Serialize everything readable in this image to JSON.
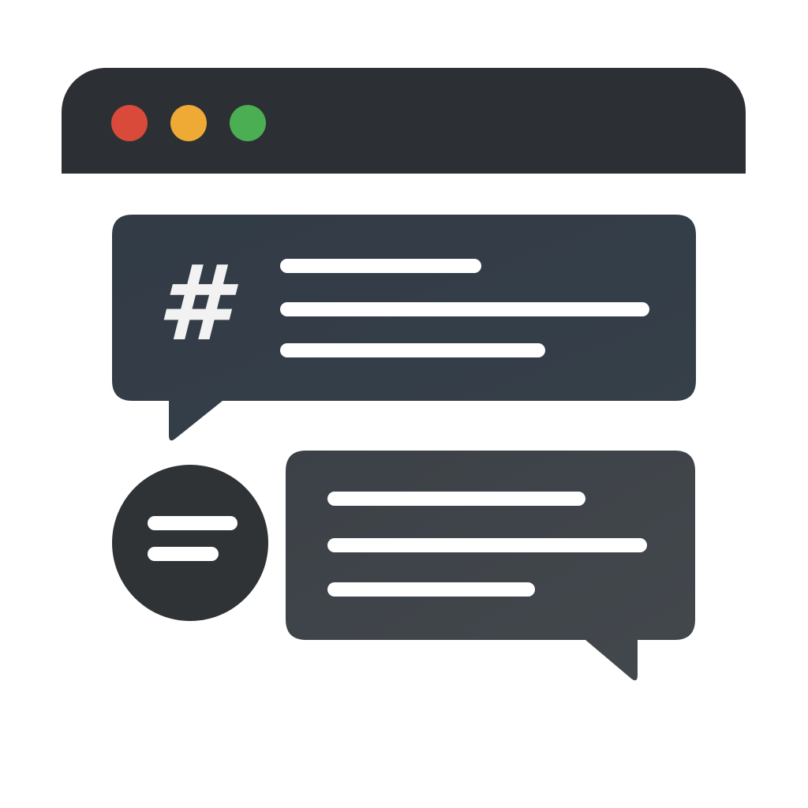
{
  "window": {
    "titlebar_color": "#2c3035",
    "controls": [
      {
        "name": "close",
        "color": "#d94a3a"
      },
      {
        "name": "minimize",
        "color": "#efa935"
      },
      {
        "name": "maximize",
        "color": "#4bae52"
      }
    ]
  },
  "channel_message": {
    "icon": "hash-icon",
    "icon_text": "#",
    "bubble_color": "#343d47",
    "text_placeholder_lines": 3
  },
  "reply_message": {
    "avatar_icon": "menu-lines-icon",
    "avatar_color": "#2f3336",
    "bubble_color": "#3f4449",
    "text_placeholder_lines": 3
  }
}
